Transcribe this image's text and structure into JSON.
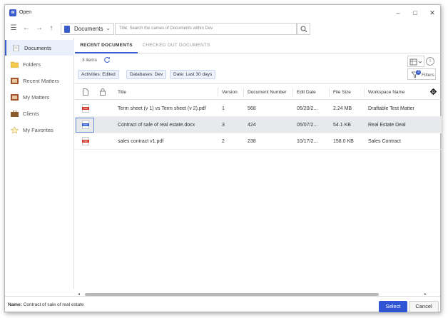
{
  "window": {
    "title": "Open",
    "app_icon_text": "W"
  },
  "navbar": {
    "location_label": "Documents",
    "search_placeholder": "Title: Search the names of Documents within Dev"
  },
  "sidebar": {
    "items": [
      {
        "label": "Documents",
        "icon": "document-icon",
        "active": true
      },
      {
        "label": "Folders",
        "icon": "folder-icon"
      },
      {
        "label": "Recent Matters",
        "icon": "recent-matters-icon"
      },
      {
        "label": "My Matters",
        "icon": "my-matters-icon"
      },
      {
        "label": "Clients",
        "icon": "clients-icon"
      },
      {
        "label": "My Favorites",
        "icon": "star-icon"
      }
    ]
  },
  "tabs": [
    {
      "label": "RECENT DOCUMENTS",
      "active": true
    },
    {
      "label": "CHECKED OUT DOCUMENTS",
      "active": false
    }
  ],
  "count_text": "3 items",
  "filters": {
    "chips": [
      "Activities: Edited",
      "Databases: Dev",
      "Date: Last 30 days"
    ],
    "button_label": "Filters",
    "badge": "3"
  },
  "table": {
    "columns": [
      "Title",
      "Version",
      "Document Number",
      "Edit Date",
      "File Size",
      "Workspace Name"
    ],
    "rows": [
      {
        "type": "pdf",
        "title": "Term sheet (v 1) vs Term sheet (v 2).pdf",
        "version": "1",
        "doc_number": "568",
        "edit_date": "05/20/2...",
        "file_size": "2.24 MB",
        "workspace": "Draftable Test Matter"
      },
      {
        "type": "docx",
        "title": "Contract of sale of real estate.docx",
        "version": "3",
        "doc_number": "424",
        "edit_date": "05/07/2...",
        "file_size": "54.1 KB",
        "workspace": "Real Estate Deal",
        "selected": true
      },
      {
        "type": "pdf",
        "title": "sales contract v1.pdf",
        "version": "2",
        "doc_number": "238",
        "edit_date": "10/17/2...",
        "file_size": "158.0 KB",
        "workspace": "Sales Contract"
      }
    ]
  },
  "footer": {
    "name_key": "Name:",
    "name_value": "Contract of sale of real estate",
    "select_label": "Select",
    "cancel_label": "Cancel"
  },
  "colors": {
    "accent": "#2f55d4",
    "selected_row": "#e7e9ed",
    "pdf": "#d9342b",
    "docx": "#2f5ccc"
  }
}
